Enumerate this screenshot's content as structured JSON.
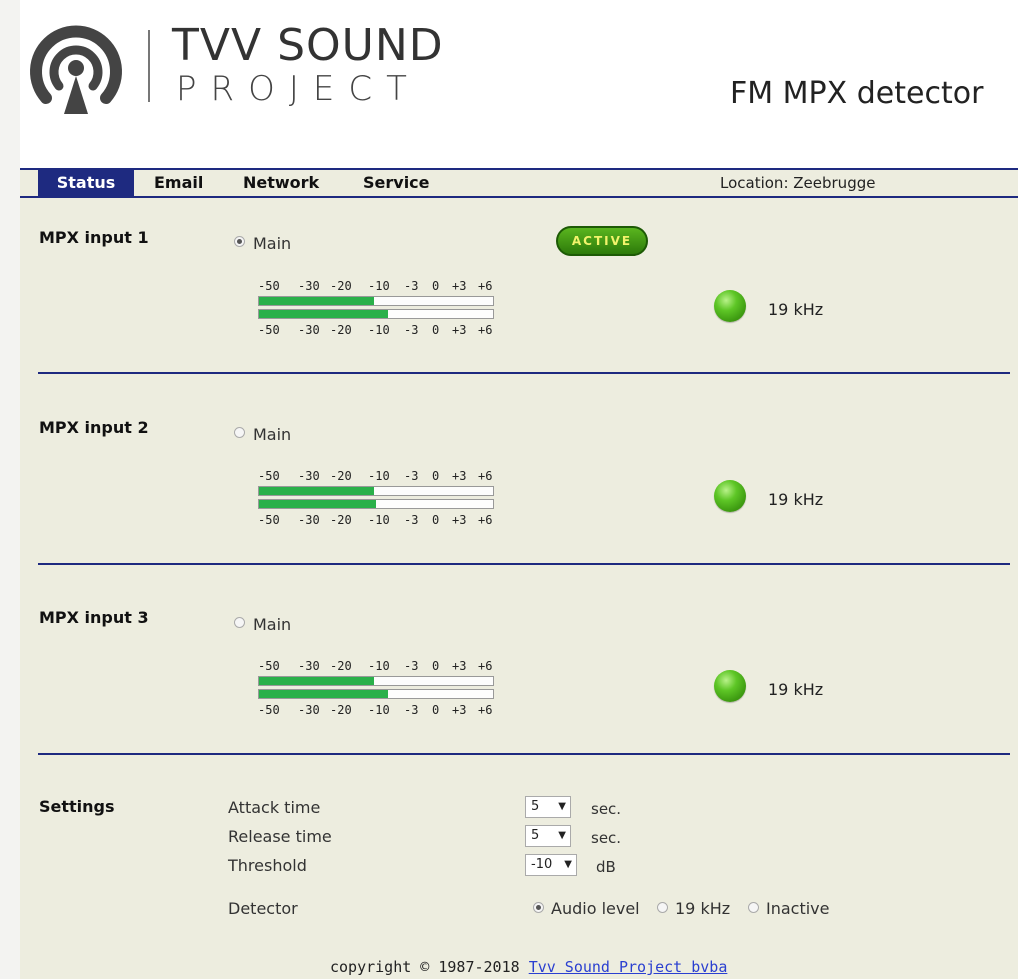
{
  "brand": {
    "line1": "TVV SOUND",
    "line2": "PROJECT"
  },
  "device_title": "FM MPX detector",
  "nav": {
    "tabs": [
      {
        "label": "Status",
        "active": true
      },
      {
        "label": "Email",
        "active": false
      },
      {
        "label": "Network",
        "active": false
      },
      {
        "label": "Service",
        "active": false
      }
    ],
    "location": "Location: Zeebrugge"
  },
  "inputs": [
    {
      "title": "MPX input 1",
      "radio_label": "Main",
      "radio_checked": true,
      "badge": "ACTIVE",
      "scale_labels": [
        "-50",
        "-30",
        "-20",
        "-10",
        "-3",
        "0",
        "+3",
        "+6"
      ],
      "meter_levels": [
        0.49,
        0.55
      ],
      "led_label": "19 kHz"
    },
    {
      "title": "MPX input 2",
      "radio_label": "Main",
      "radio_checked": false,
      "scale_labels": [
        "-50",
        "-30",
        "-20",
        "-10",
        "-3",
        "0",
        "+3",
        "+6"
      ],
      "meter_levels": [
        0.49,
        0.5
      ],
      "led_label": "19 kHz"
    },
    {
      "title": "MPX input 3",
      "radio_label": "Main",
      "radio_checked": false,
      "scale_labels": [
        "-50",
        "-30",
        "-20",
        "-10",
        "-3",
        "0",
        "+3",
        "+6"
      ],
      "meter_levels": [
        0.49,
        0.55
      ],
      "led_label": "19 kHz"
    }
  ],
  "settings": {
    "title": "Settings",
    "attack": {
      "label": "Attack time",
      "value": "5",
      "unit": "sec."
    },
    "release": {
      "label": "Release time",
      "value": "5",
      "unit": "sec."
    },
    "threshold": {
      "label": "Threshold",
      "value": "-10",
      "unit": "dB"
    },
    "detector": {
      "label": "Detector",
      "options": [
        {
          "label": "Audio level",
          "checked": true
        },
        {
          "label": "19 kHz",
          "checked": false
        },
        {
          "label": "Inactive",
          "checked": false
        }
      ]
    }
  },
  "footer": {
    "text": "copyright © 1987-2018",
    "link": "Tvv Sound Project bvba"
  },
  "colors": {
    "nav_accent": "#1e2a80",
    "panel_bg": "#ededdf",
    "meter_fill": "#2ab04a",
    "led_green": "#5ec626",
    "link": "#2a3fd0"
  }
}
